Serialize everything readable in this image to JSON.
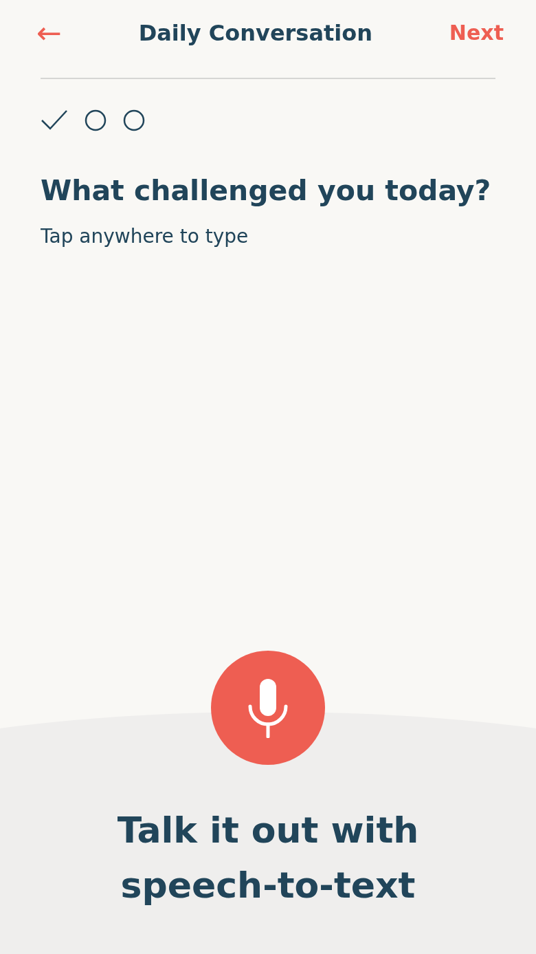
{
  "header": {
    "back_label": "←",
    "title": "Daily Conversation",
    "next_label": "Next"
  },
  "steps": [
    {
      "completed": true
    },
    {
      "completed": false
    },
    {
      "completed": false
    }
  ],
  "question": "What challenged you today?",
  "answer": {
    "placeholder": "Tap anywhere to type"
  },
  "speech_prompt": "Talk it out with speech-to-text"
}
